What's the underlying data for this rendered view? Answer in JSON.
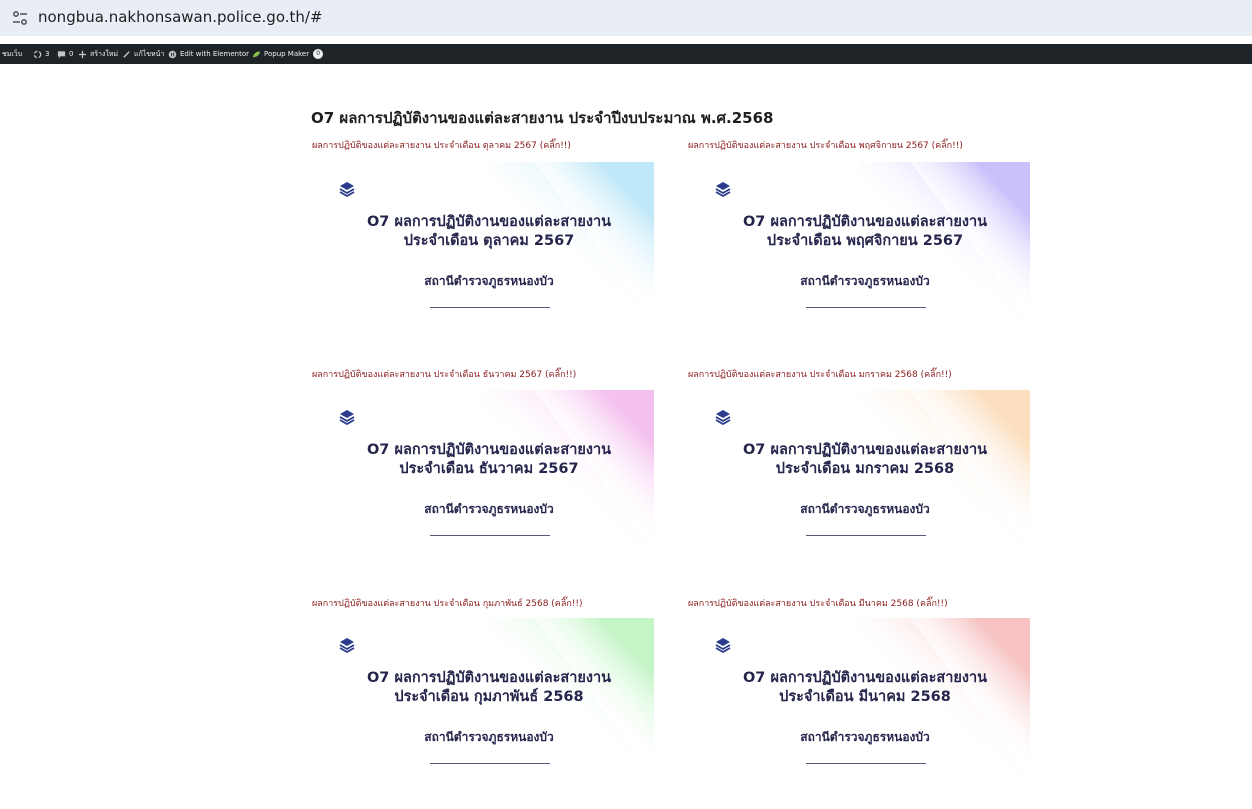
{
  "browser": {
    "url": "nongbua.nakhonsawan.police.go.th/#"
  },
  "admin_bar": {
    "site_label": "ชมเว็บ",
    "updates_count": "3",
    "comments_count": "0",
    "new_label": "สร้างใหม่",
    "edit_label": "แก้ไขหน้า",
    "elementor_label": "Edit with Elementor",
    "popup_label": "Popup Maker",
    "popup_badge": "0"
  },
  "page": {
    "title": "O7 ผลการปฏิบัติงานของแต่ละสายงาน ประจำปีงบประมาณ พ.ศ.2568"
  },
  "cards": [
    {
      "label": "ผลการปฏิบัติของแต่ละสายงาน ประจำเดือน ตุลาคม 2567 (คลิ๊ก!!)",
      "title_line1": "O7 ผลการปฏิบัติงานของแต่ละสายงาน",
      "title_line2": "ประจำเดือน ตุลาคม 2567",
      "subtitle": "สถานีตำรวจภูธรหนองบัว",
      "accent": "#bfe8f8"
    },
    {
      "label": "ผลการปฏิบัติของแต่ละสายงาน ประจำเดือน พฤศจิกายน 2567 (คลิ๊ก!!)",
      "title_line1": "O7 ผลการปฏิบัติงานของแต่ละสายงาน",
      "title_line2": "ประจำเดือน พฤศจิกายน 2567",
      "subtitle": "สถานีตำรวจภูธรหนองบัว",
      "accent": "#c9c1fb"
    },
    {
      "label": "ผลการปฏิบัติของแต่ละสายงาน ประจำเดือน ธันวาคม 2567 (คลิ๊ก!!)",
      "title_line1": "O7 ผลการปฏิบัติงานของแต่ละสายงาน",
      "title_line2": "ประจำเดือน ธันวาคม 2567",
      "subtitle": "สถานีตำรวจภูธรหนองบัว",
      "accent": "#f5c2ef"
    },
    {
      "label": "ผลการปฏิบัติของแต่ละสายงาน ประจำเดือน มกราคม 2568 (คลิ๊ก!!)",
      "title_line1": "O7 ผลการปฏิบัติงานของแต่ละสายงาน",
      "title_line2": "ประจำเดือน มกราคม 2568",
      "subtitle": "สถานีตำรวจภูธรหนองบัว",
      "accent": "#fbdfbf"
    },
    {
      "label": "ผลการปฏิบัติของแต่ละสายงาน ประจำเดือน กุมภาพันธ์ 2568 (คลิ๊ก!!)",
      "title_line1": "O7 ผลการปฏิบัติงานของแต่ละสายงาน",
      "title_line2": "ประจำเดือน กุมภาพันธ์ 2568",
      "subtitle": "สถานีตำรวจภูธรหนองบัว",
      "accent": "#c4f5c6"
    },
    {
      "label": "ผลการปฏิบัติของแต่ละสายงาน ประจำเดือน มีนาคม 2568 (คลิ๊ก!!)",
      "title_line1": "O7 ผลการปฏิบัติงานของแต่ละสายงาน",
      "title_line2": "ประจำเดือน มีนาคม 2568",
      "subtitle": "สถานีตำรวจภูธรหนองบัว",
      "accent": "#f7c2c2"
    }
  ]
}
